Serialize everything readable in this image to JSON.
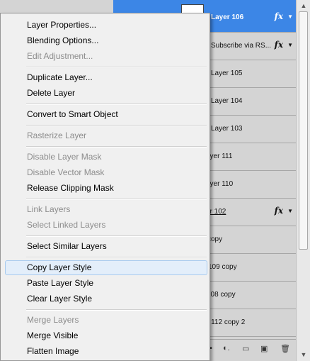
{
  "layers_panel": {
    "rows": [
      {
        "name": "Layer 106",
        "fx": "fx",
        "selected": true
      },
      {
        "name": "Subscribe via RS...",
        "fx": "fx",
        "selected": false
      },
      {
        "name": "Layer 105",
        "fx": "",
        "selected": false
      },
      {
        "name": "Layer 104",
        "fx": "",
        "selected": false
      },
      {
        "name": "Layer 103",
        "fx": "",
        "selected": false
      },
      {
        "name": "ayer 111",
        "fx": "",
        "selected": false
      },
      {
        "name": "ayer 110",
        "fx": "",
        "selected": false
      },
      {
        "name": "er 102",
        "fx": "fx",
        "selected": false
      },
      {
        "name": "copy",
        "fx": "",
        "selected": false
      },
      {
        "name": "109 copy",
        "fx": "",
        "selected": false
      },
      {
        "name": "108 copy",
        "fx": "",
        "selected": false
      },
      {
        "name": "r 112 copy 2",
        "fx": "",
        "selected": false
      }
    ],
    "accent_color": "#3c86e6"
  },
  "context_menu": {
    "items": [
      {
        "label": "Layer Properties...",
        "enabled": true
      },
      {
        "label": "Blending Options...",
        "enabled": true
      },
      {
        "label": "Edit Adjustment...",
        "enabled": false
      },
      {
        "label": "Duplicate Layer...",
        "enabled": true
      },
      {
        "label": "Delete Layer",
        "enabled": true
      },
      {
        "label": "Convert to Smart Object",
        "enabled": true
      },
      {
        "label": "Rasterize Layer",
        "enabled": false
      },
      {
        "label": "Disable Layer Mask",
        "enabled": false
      },
      {
        "label": "Disable Vector Mask",
        "enabled": false
      },
      {
        "label": "Release Clipping Mask",
        "enabled": true
      },
      {
        "label": "Link Layers",
        "enabled": false
      },
      {
        "label": "Select Linked Layers",
        "enabled": false
      },
      {
        "label": "Select Similar Layers",
        "enabled": true
      },
      {
        "label": "Copy Layer Style",
        "enabled": true,
        "hover": true
      },
      {
        "label": "Paste Layer Style",
        "enabled": true
      },
      {
        "label": "Clear Layer Style",
        "enabled": true
      },
      {
        "label": "Merge Layers",
        "enabled": false
      },
      {
        "label": "Merge Visible",
        "enabled": true
      },
      {
        "label": "Flatten Image",
        "enabled": true
      }
    ]
  },
  "icons": {
    "scroll_up": "scroll-up-arrow",
    "scroll_down": "scroll-down-arrow",
    "fx_menu": "fx-dropdown-arrow",
    "bottom": [
      "adjustment-icon",
      "folder-icon",
      "new-layer-icon",
      "trash-icon"
    ]
  }
}
